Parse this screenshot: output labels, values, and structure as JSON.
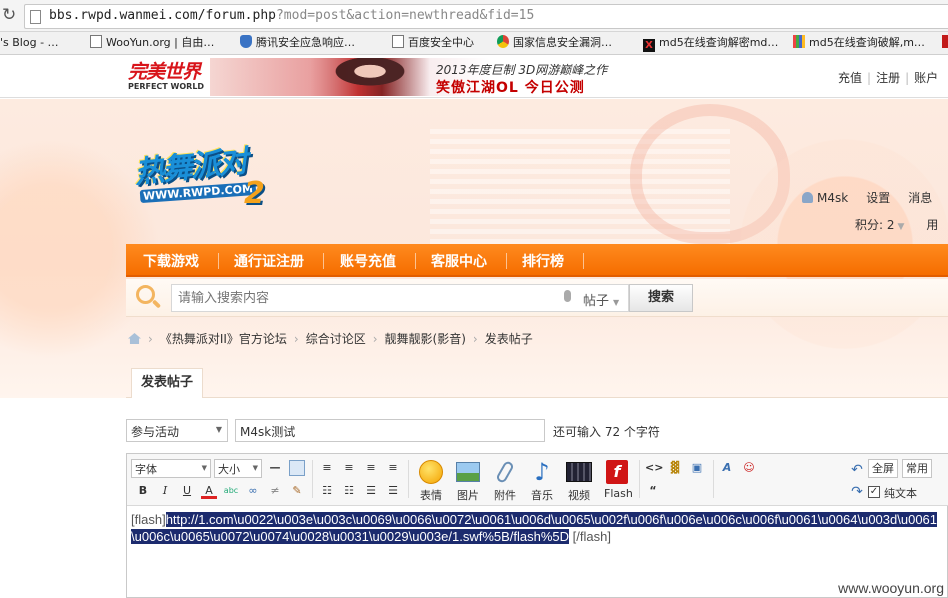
{
  "browser": {
    "url_main": "bbs.rwpd.wanmei.com/forum.php",
    "url_query": "?mod=post&action=newthread&fid=15",
    "bookmarks": [
      {
        "label": "'s Blog - …",
        "icon": "none"
      },
      {
        "label": "WooYun.org | 自由…",
        "icon": "page"
      },
      {
        "label": "腾讯安全应急响应…",
        "icon": "shield"
      },
      {
        "label": "百度安全中心",
        "icon": "page"
      },
      {
        "label": "国家信息安全漏洞…",
        "icon": "chrome"
      },
      {
        "label": "md5在线查询解密md…",
        "icon": "blackx"
      },
      {
        "label": "md5在线查询破解,m…",
        "icon": "grid"
      }
    ]
  },
  "site": {
    "brand_cn": "完美世界",
    "brand_en": "PERFECT WORLD",
    "banner_line1": "2013年度巨制 3D网游巅峰之作",
    "banner_line2": "笑傲江湖OL 今日公测",
    "top_links": [
      "充值",
      "注册",
      "账户"
    ]
  },
  "logo": {
    "word": "热舞派对",
    "url": "WWW.RWPD.COM",
    "number": "2"
  },
  "user": {
    "name": "M4sk",
    "settings": "设置",
    "messages": "消息",
    "credits": "积分: 2",
    "more": "用"
  },
  "nav": [
    "下载游戏",
    "通行证注册",
    "账号充值",
    "客服中心",
    "排行榜"
  ],
  "search": {
    "placeholder": "请输入搜索内容",
    "type": "帖子",
    "button": "搜索"
  },
  "breadcrumb": [
    "《热舞派对II》官方论坛",
    "综合讨论区",
    "靓舞靓影(影音)",
    "发表帖子"
  ],
  "tab": "发表帖子",
  "form": {
    "category": "参与活动",
    "title": "M4sk测试",
    "remaining": "还可输入 72 个字符"
  },
  "editor": {
    "font_label": "字体",
    "size_label": "大小",
    "big_buttons": [
      "表情",
      "图片",
      "附件",
      "音乐",
      "视频",
      "Flash"
    ],
    "fullscreen": "全屏",
    "common": "常用",
    "plain_text": "纯文本",
    "content_open_tag": "[flash]",
    "content_payload": "http://1.com\\u0022\\u003e\\u003c\\u0069\\u0066\\u0072\\u0061\\u006d\\u0065\\u002f\\u006f\\u006e\\u006c\\u006f\\u0061\\u0064\\u003d\\u0061\\u006c\\u0065\\u0072\\u0074\\u0028\\u0031\\u0029\\u003e/1.swf%5B/flash%5D",
    "content_close_tag": "[/flash]"
  },
  "watermark": "www.wooyun.org"
}
